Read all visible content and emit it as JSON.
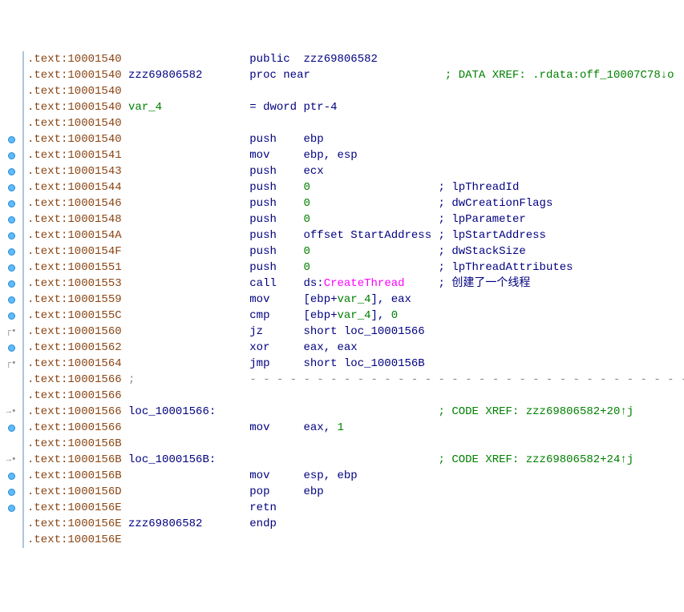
{
  "lines": [
    {
      "g": "",
      "addr": ".text:10001540",
      "label": "",
      "inst": "public",
      "op": "zzz69806582",
      "cmt": "",
      "xref": ""
    },
    {
      "g": "",
      "addr": ".text:10001540",
      "label": "zzz69806582",
      "inst": "proc near",
      "op": "",
      "cmt": "",
      "xref": "; DATA XREF: .rdata:off_10007C78↓o"
    },
    {
      "g": "",
      "addr": ".text:10001540",
      "label": "",
      "inst": "",
      "op": "",
      "cmt": "",
      "xref": ""
    },
    {
      "g": "",
      "addr": ".text:10001540",
      "label": "var_4",
      "inst": "= dword ptr",
      "op": "-4",
      "cmt": "",
      "xref": ""
    },
    {
      "g": "",
      "addr": ".text:10001540",
      "label": "",
      "inst": "",
      "op": "",
      "cmt": "",
      "xref": ""
    },
    {
      "g": "dot",
      "addr": ".text:10001540",
      "label": "",
      "inst": "push",
      "op": "ebp",
      "cmt": "",
      "xref": ""
    },
    {
      "g": "dot",
      "addr": ".text:10001541",
      "label": "",
      "inst": "mov",
      "op": "ebp, esp",
      "cmt": "",
      "xref": ""
    },
    {
      "g": "dot",
      "addr": ".text:10001543",
      "label": "",
      "inst": "push",
      "op": "ecx",
      "cmt": "",
      "xref": ""
    },
    {
      "g": "dot",
      "addr": ".text:10001544",
      "label": "",
      "inst": "push",
      "op": "0",
      "cmt": "; lpThreadId",
      "xref": ""
    },
    {
      "g": "dot",
      "addr": ".text:10001546",
      "label": "",
      "inst": "push",
      "op": "0",
      "cmt": "; dwCreationFlags",
      "xref": ""
    },
    {
      "g": "dot",
      "addr": ".text:10001548",
      "label": "",
      "inst": "push",
      "op": "0",
      "cmt": "; lpParameter",
      "xref": ""
    },
    {
      "g": "dot",
      "addr": ".text:1000154A",
      "label": "",
      "inst": "push",
      "op": "offset StartAddress",
      "cmt": "; lpStartAddress",
      "xref": ""
    },
    {
      "g": "dot",
      "addr": ".text:1000154F",
      "label": "",
      "inst": "push",
      "op": "0",
      "cmt": "; dwStackSize",
      "xref": ""
    },
    {
      "g": "dot",
      "addr": ".text:10001551",
      "label": "",
      "inst": "push",
      "op": "0",
      "cmt": "; lpThreadAttributes",
      "xref": ""
    },
    {
      "g": "dot",
      "addr": ".text:10001553",
      "label": "",
      "inst": "call",
      "op": "ds:CreateThread",
      "cmt": "; 创建了一个线程",
      "xref": ""
    },
    {
      "g": "dot",
      "addr": ".text:10001559",
      "label": "",
      "inst": "mov",
      "op": "[ebp+var_4], eax",
      "cmt": "",
      "xref": ""
    },
    {
      "g": "dot",
      "addr": ".text:1000155C",
      "label": "",
      "inst": "cmp",
      "op": "[ebp+var_4], 0",
      "cmt": "",
      "xref": ""
    },
    {
      "g": "br",
      "addr": ".text:10001560",
      "label": "",
      "inst": "jz",
      "op": "short loc_10001566",
      "cmt": "",
      "xref": ""
    },
    {
      "g": "dot",
      "addr": ".text:10001562",
      "label": "",
      "inst": "xor",
      "op": "eax, eax",
      "cmt": "",
      "xref": ""
    },
    {
      "g": "br",
      "addr": ".text:10001564",
      "label": "",
      "inst": "jmp",
      "op": "short loc_1000156B",
      "cmt": "",
      "xref": ""
    },
    {
      "g": "",
      "addr": ".text:10001566",
      "label": ";",
      "inst": "dash",
      "op": "",
      "cmt": "",
      "xref": ""
    },
    {
      "g": "",
      "addr": ".text:10001566",
      "label": "",
      "inst": "",
      "op": "",
      "cmt": "",
      "xref": ""
    },
    {
      "g": "arr",
      "addr": ".text:10001566",
      "label": "loc_10001566:",
      "inst": "",
      "op": "",
      "cmt": "",
      "xref": "; CODE XREF: zzz69806582+20↑j"
    },
    {
      "g": "dot",
      "addr": ".text:10001566",
      "label": "",
      "inst": "mov",
      "op": "eax, 1",
      "cmt": "",
      "xref": ""
    },
    {
      "g": "",
      "addr": ".text:1000156B",
      "label": "",
      "inst": "",
      "op": "",
      "cmt": "",
      "xref": ""
    },
    {
      "g": "arr",
      "addr": ".text:1000156B",
      "label": "loc_1000156B:",
      "inst": "",
      "op": "",
      "cmt": "",
      "xref": "; CODE XREF: zzz69806582+24↑j"
    },
    {
      "g": "dot",
      "addr": ".text:1000156B",
      "label": "",
      "inst": "mov",
      "op": "esp, ebp",
      "cmt": "",
      "xref": ""
    },
    {
      "g": "dot",
      "addr": ".text:1000156D",
      "label": "",
      "inst": "pop",
      "op": "ebp",
      "cmt": "",
      "xref": ""
    },
    {
      "g": "dot",
      "addr": ".text:1000156E",
      "label": "",
      "inst": "retn",
      "op": "",
      "cmt": "",
      "xref": ""
    },
    {
      "g": "",
      "addr": ".text:1000156E",
      "label": "zzz69806582",
      "inst": "endp",
      "op": "",
      "cmt": "",
      "xref": ""
    },
    {
      "g": "",
      "addr": ".text:1000156E",
      "label": "",
      "inst": "",
      "op": "",
      "cmt": "",
      "xref": ""
    }
  ]
}
